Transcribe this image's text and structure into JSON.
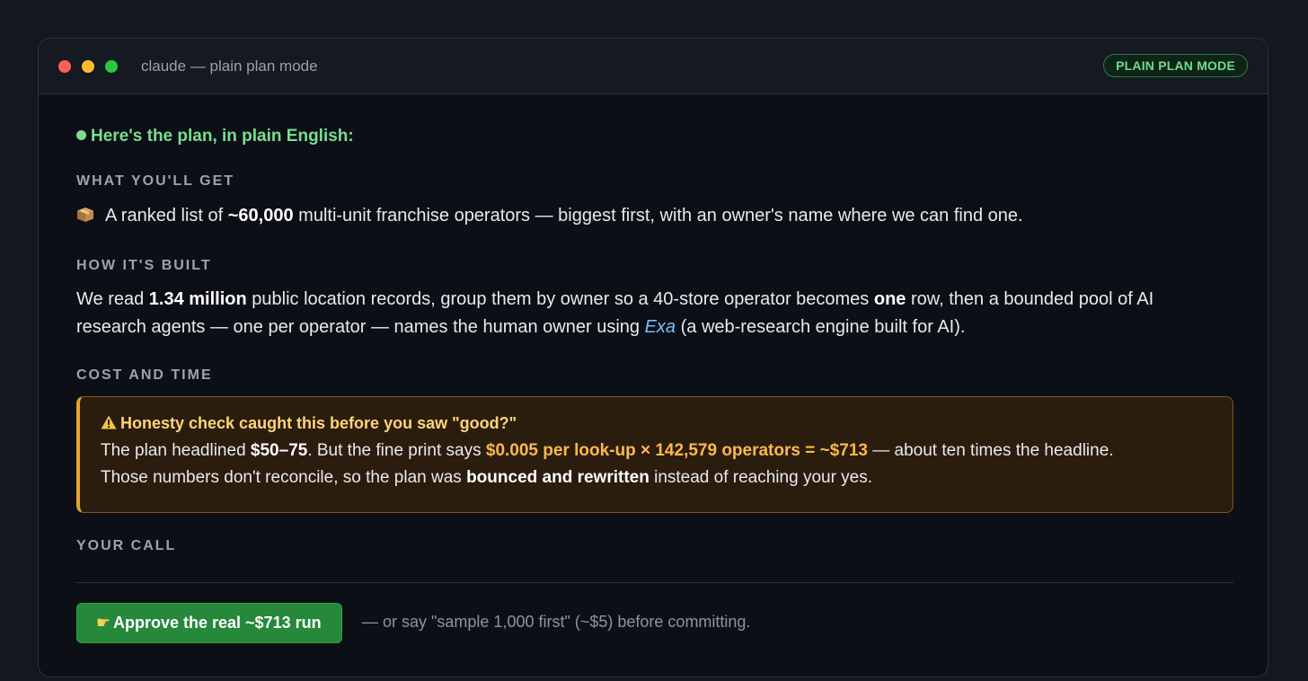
{
  "window": {
    "title": "claude — plain plan mode",
    "badge": "PLAIN PLAN MODE"
  },
  "intro": "Here's the plan, in plain English:",
  "sections": {
    "get": {
      "label": "WHAT YOU'LL GET",
      "icon": "package-icon",
      "text1": "A ranked list of ",
      "bold1": "~60,000",
      "text2": " multi-unit franchise operators — biggest first, with an owner's name where we can find one."
    },
    "built": {
      "label": "HOW IT'S BUILT",
      "line1_a": "We read ",
      "line1_b": "1.34 million",
      "line1_c": " public location records, group them by owner so a 40-store operator becomes ",
      "line1_d": "one",
      "line1_e": " row, then a bounded pool of AI",
      "line2_a": "research agents — one per operator — names the human owner using ",
      "line2_b": "Exa",
      "line2_c": " (a web-research engine built for AI)."
    },
    "cost": {
      "label": "COST AND TIME",
      "warn_icon": "warning-icon",
      "warn_title": "Honesty check caught this before you saw \"good?\"",
      "l1_a": "The plan headlined ",
      "l1_b": "$50–75",
      "l1_c": ". But the fine print says ",
      "l1_d": "$0.005 per look-up × 142,579 operators = ~$713",
      "l1_e": " — about ten times the headline.",
      "l2_a": "Those numbers don't reconcile, so the plan was ",
      "l2_b": "bounced and rewritten",
      "l2_c": " instead of reaching your yes."
    },
    "call": {
      "label": "YOUR CALL",
      "button_icon": "pointing-hand-icon",
      "button_label": "Approve the real ~$713 run",
      "hint": "— or say \"sample 1,000 first\" (~$5) before committing."
    }
  },
  "colors": {
    "accent_green": "#79de8f",
    "warning_amber": "#ffb84d",
    "button_green": "#25883b"
  }
}
